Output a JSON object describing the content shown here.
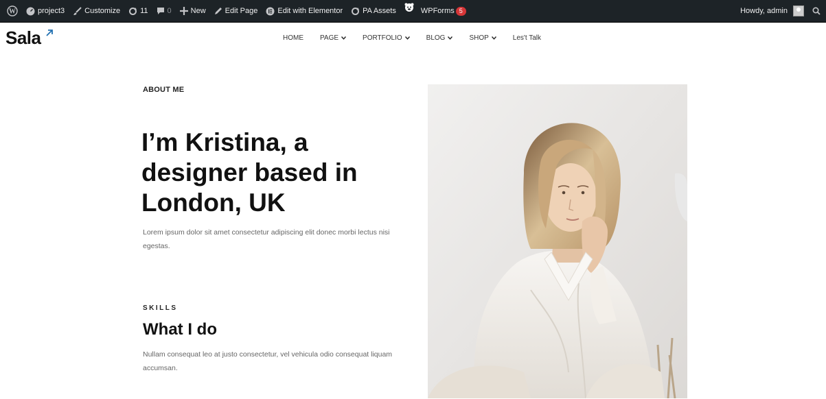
{
  "adminbar": {
    "site_name": "project3",
    "customize": "Customize",
    "updates_count": "11",
    "comments_count": "0",
    "new_label": "New",
    "edit_page": "Edit Page",
    "edit_elementor": "Edit with Elementor",
    "pa_assets": "PA Assets",
    "wpforms": "WPForms",
    "wpforms_badge": "5",
    "howdy": "Howdy, admin"
  },
  "header": {
    "logo": "Sala",
    "nav": [
      {
        "label": "HOME",
        "has_dropdown": false
      },
      {
        "label": "PAGE",
        "has_dropdown": true
      },
      {
        "label": "PORTFOLIO",
        "has_dropdown": true
      },
      {
        "label": "BLOG",
        "has_dropdown": true
      },
      {
        "label": "SHOP",
        "has_dropdown": true
      },
      {
        "label": "Les't Talk",
        "has_dropdown": false
      }
    ]
  },
  "about": {
    "label": "ABOUT ME",
    "title": "I’m Kristina, a designer based in London, UK",
    "description": "Lorem ipsum dolor sit amet consectetur adipiscing elit donec morbi lectus nisi egestas."
  },
  "skills": {
    "label": "SKILLS",
    "title": "What I do",
    "description": "Nullam consequat leo at justo consectetur, vel vehicula odio consequat liquam accumsan."
  },
  "colors": {
    "adminbar_bg": "#1d2327",
    "accent_blue": "#2271b1",
    "badge_red": "#d63638",
    "text_dark": "#111111",
    "text_muted": "#666666"
  }
}
